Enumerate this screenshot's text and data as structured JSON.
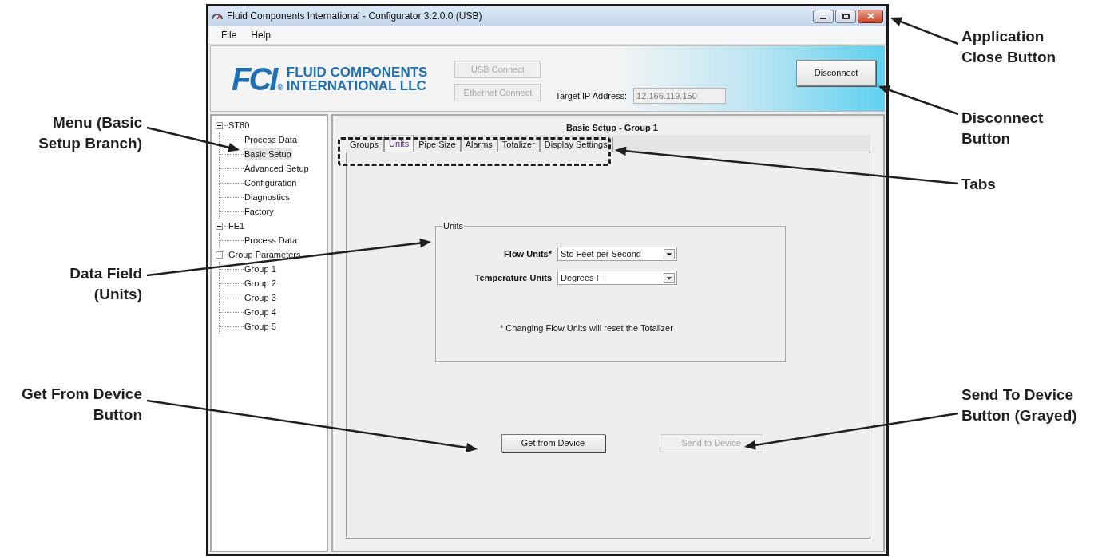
{
  "window": {
    "title": "Fluid Components International - Configurator 3.2.0.0 (USB)"
  },
  "menu": [
    "File",
    "Help"
  ],
  "header": {
    "logo_mark": "FCI",
    "logo_reg": "®",
    "logo_lines": [
      "FLUID COMPONENTS",
      "INTERNATIONAL LLC"
    ],
    "connect_buttons": [
      {
        "label": "USB Connect",
        "disabled": true
      },
      {
        "label": "Ethernet Connect",
        "disabled": true
      }
    ],
    "ip_label": "Target IP Address:",
    "ip_value": "12.166.119.150",
    "disconnect": "Disconnect"
  },
  "tree": [
    {
      "label": "ST80",
      "expanded": true,
      "selected": false,
      "children": [
        {
          "label": "Process Data",
          "selected": false
        },
        {
          "label": "Basic Setup",
          "selected": true
        },
        {
          "label": "Advanced Setup",
          "selected": false
        },
        {
          "label": "Configuration",
          "selected": false
        },
        {
          "label": "Diagnostics",
          "selected": false
        },
        {
          "label": "Factory",
          "selected": false
        }
      ]
    },
    {
      "label": "FE1",
      "expanded": true,
      "selected": false,
      "children": [
        {
          "label": "Process Data",
          "selected": false
        }
      ]
    },
    {
      "label": "Group Parameters",
      "expanded": true,
      "selected": false,
      "children": [
        {
          "label": "Group 1",
          "selected": false
        },
        {
          "label": "Group 2",
          "selected": false
        },
        {
          "label": "Group 3",
          "selected": false
        },
        {
          "label": "Group 4",
          "selected": false
        },
        {
          "label": "Group 5",
          "selected": false
        }
      ]
    }
  ],
  "panel": {
    "title": "Basic Setup - Group 1",
    "tabs": [
      {
        "label": "Groups",
        "selected": false
      },
      {
        "label": "Units",
        "selected": true
      },
      {
        "label": "Pipe Size",
        "selected": false
      },
      {
        "label": "Alarms",
        "selected": false
      },
      {
        "label": "Totalizer",
        "selected": false
      },
      {
        "label": "Display Settings",
        "selected": false
      }
    ],
    "group": {
      "legend": "Units",
      "fields": [
        {
          "label": "Flow Units*",
          "value": "Std Feet per Second"
        },
        {
          "label": "Temperature Units",
          "value": "Degrees F"
        }
      ],
      "note": "* Changing Flow Units will reset the Totalizer"
    },
    "buttons": [
      {
        "label": "Get from Device",
        "disabled": false
      },
      {
        "label": "Send to Device",
        "disabled": true
      }
    ]
  },
  "callouts": [
    {
      "kind": "right",
      "lines": [
        "Application",
        "Close Button"
      ]
    },
    {
      "kind": "right",
      "lines": [
        "Disconnect",
        "Button"
      ]
    },
    {
      "kind": "right",
      "lines": [
        "Tabs"
      ]
    },
    {
      "kind": "left",
      "lines": [
        "Menu (Basic",
        "Setup Branch)"
      ]
    },
    {
      "kind": "left",
      "lines": [
        "Data Field",
        "(Units)"
      ]
    },
    {
      "kind": "left",
      "lines": [
        "Get From Device",
        "Button"
      ]
    },
    {
      "kind": "right",
      "lines": [
        "Send To Device",
        "Button (Grayed)"
      ]
    }
  ]
}
